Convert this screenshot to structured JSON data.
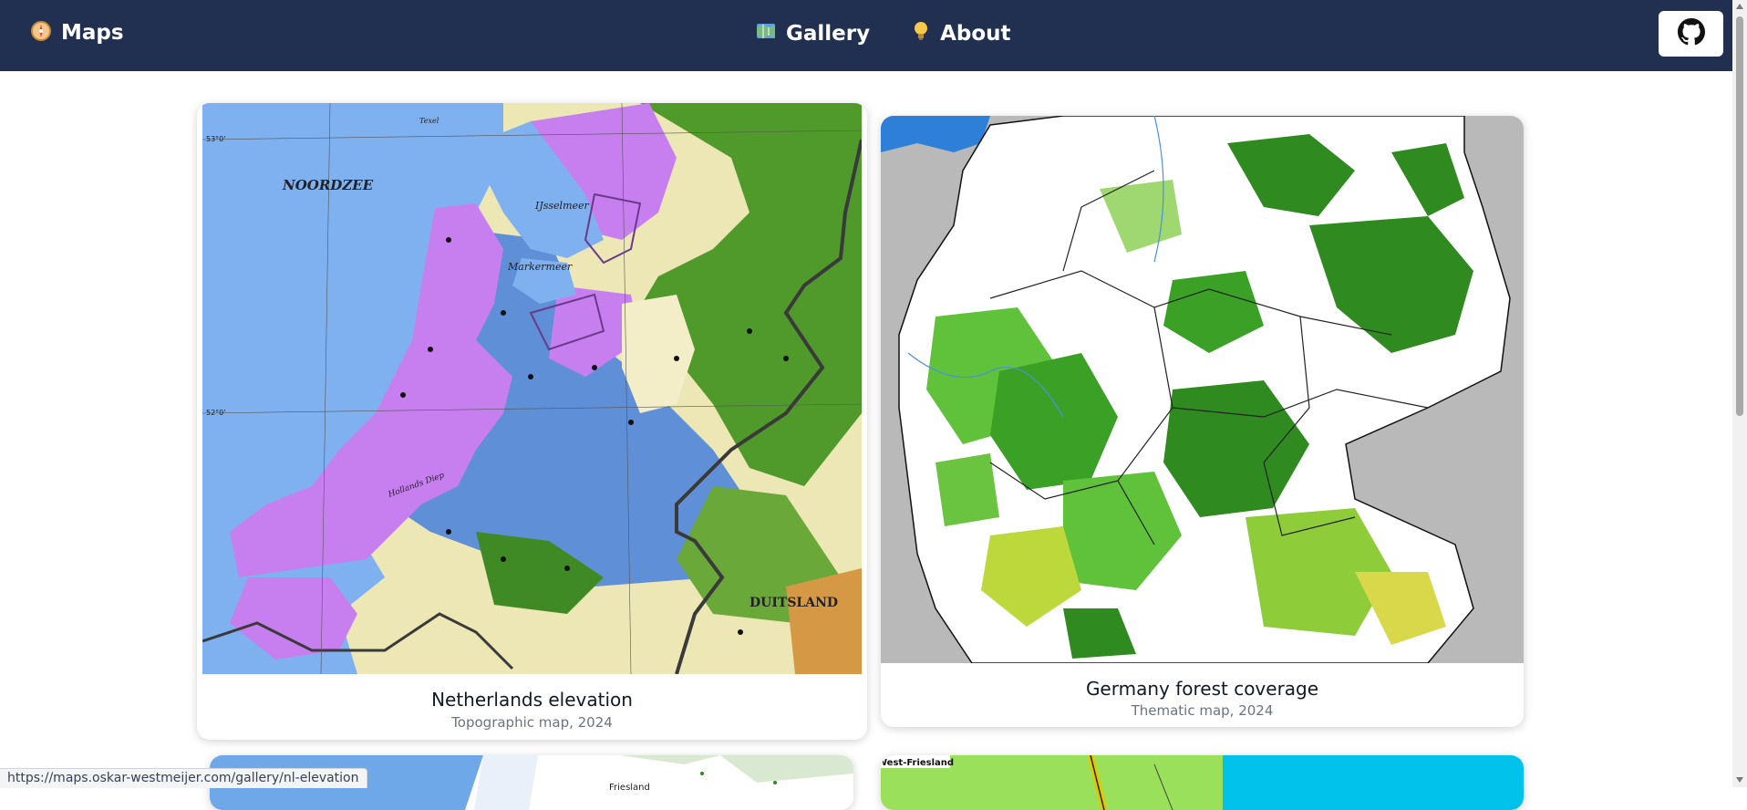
{
  "nav": {
    "brand_label": "Maps",
    "brand_icon": "compass-icon",
    "links": [
      {
        "label": "Gallery",
        "icon": "map-icon"
      },
      {
        "label": "About",
        "icon": "lightbulb-icon"
      }
    ],
    "github_icon": "github-icon",
    "colors": {
      "bar": "#213050",
      "text": "#ffffff"
    }
  },
  "cards": [
    {
      "title": "Netherlands elevation",
      "subtitle": "Topographic map, 2024",
      "map_labels": {
        "sea": "NOORDZEE",
        "lake1": "IJsselmeer",
        "lake2": "Markermeer",
        "country": "DUITSLAND",
        "lat1": "53°0'",
        "lat2": "52°0'",
        "island": "Texel",
        "river": "Hollands Diep"
      }
    },
    {
      "title": "Germany forest coverage",
      "subtitle": "Thematic map, 2024"
    }
  ],
  "lower_cards": {
    "card3_labels": [
      "Friesland"
    ],
    "card4_label": "West-Friesland"
  },
  "status_bar": {
    "url": "https://maps.oskar-westmeijer.com/gallery/nl-elevation"
  }
}
